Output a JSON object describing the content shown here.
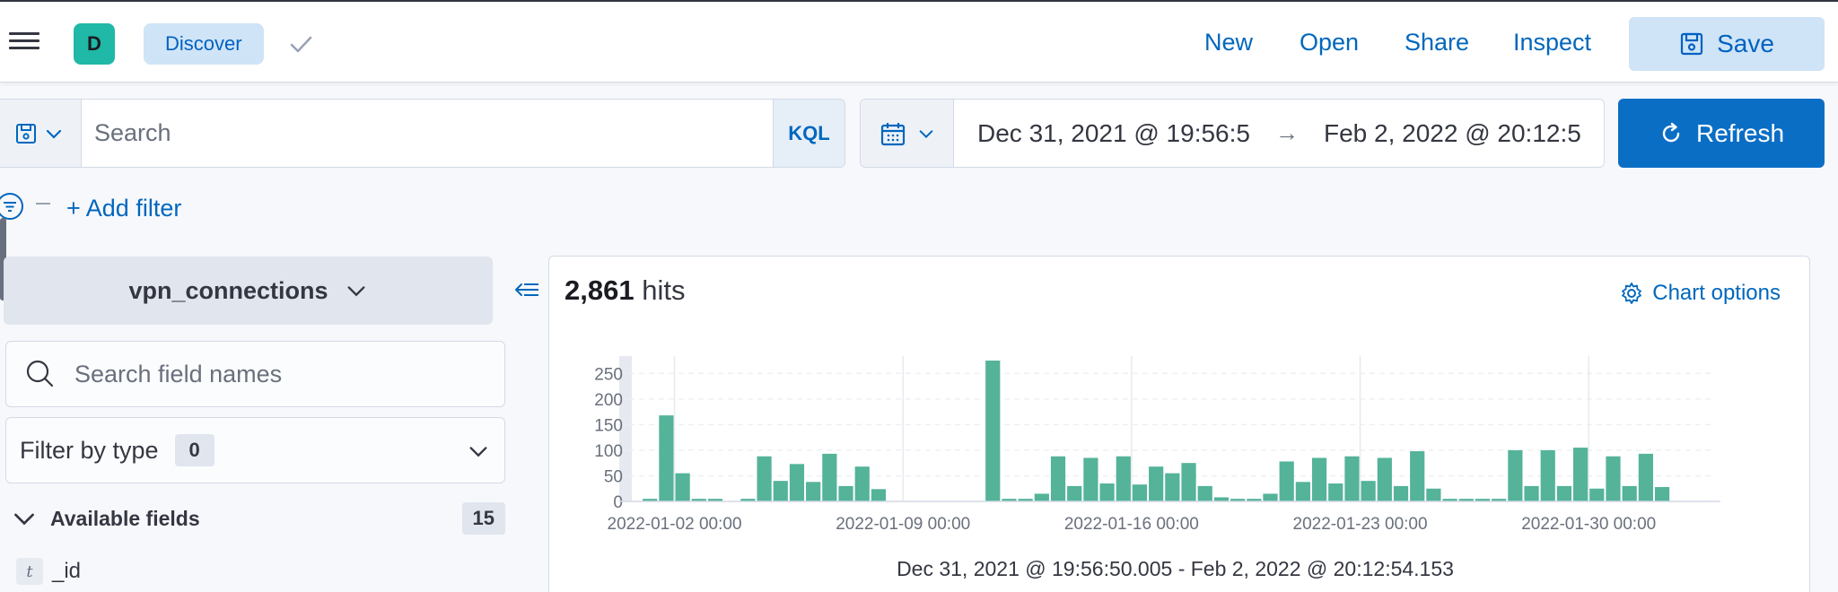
{
  "header": {
    "avatar_letter": "D",
    "breadcrumb": "Discover",
    "links": [
      "New",
      "Open",
      "Share",
      "Inspect"
    ],
    "save_label": "Save"
  },
  "query": {
    "placeholder": "Search",
    "language": "KQL",
    "date_start": "Dec 31, 2021 @ 19:56:5",
    "date_end": "Feb 2, 2022 @ 20:12:5",
    "refresh_label": "Refresh"
  },
  "filters": {
    "add_label": "+ Add filter"
  },
  "sidebar": {
    "index_pattern": "vpn_connections",
    "field_search_placeholder": "Search field names",
    "filter_by_type_label": "Filter by type",
    "filter_by_type_count": "0",
    "available_fields_label": "Available fields",
    "available_fields_count": "15",
    "fields": [
      {
        "type": "t",
        "name": "_id"
      }
    ]
  },
  "main": {
    "hits_count": "2,861",
    "hits_label": "hits",
    "chart_options_label": "Chart options"
  },
  "colors": {
    "bar": "#54b399",
    "accent": "#0b6ec5",
    "link": "#0067bd"
  },
  "chart_data": {
    "type": "bar",
    "xlabel": "Dec 31, 2021 @ 19:56:50.005 - Feb 2, 2022 @ 20:12:54.153",
    "ylabel": "",
    "ylim": [
      0,
      275
    ],
    "yticks": [
      0,
      50,
      100,
      150,
      200,
      250
    ],
    "x_tick_labels": [
      "2022-01-02 00:00",
      "2022-01-09 00:00",
      "2022-01-16 00:00",
      "2022-01-23 00:00",
      "2022-01-30 00:00"
    ],
    "interval": "12 hours",
    "values": [
      5,
      168,
      55,
      5,
      5,
      0,
      0,
      5,
      88,
      40,
      73,
      38,
      93,
      30,
      68,
      24,
      0,
      0,
      0,
      0,
      0,
      0,
      0,
      0,
      0,
      0,
      0,
      0,
      0,
      0,
      0,
      0,
      0,
      0,
      0,
      0,
      0,
      0,
      0,
      0,
      0,
      0,
      0,
      0,
      0,
      0,
      0,
      0,
      0,
      0,
      0,
      0,
      0,
      0,
      0,
      0,
      0,
      0,
      0,
      0,
      0,
      0,
      0,
      0
    ],
    "series": [
      {
        "name": "Count",
        "values": [
          5,
          168,
          55,
          5,
          5,
          0,
          0,
          5,
          88,
          40,
          73,
          38,
          93,
          30,
          68,
          24,
          0,
          0,
          0,
          0,
          0,
          0,
          0,
          0,
          0,
          0,
          0,
          0,
          0,
          0,
          0,
          0,
          0,
          0,
          0,
          0,
          0,
          0,
          0,
          0,
          0,
          0,
          0,
          0,
          0,
          0,
          0,
          0,
          0,
          0,
          0,
          0,
          0,
          0,
          0,
          0,
          0,
          0,
          0,
          0,
          0,
          0,
          0,
          0
        ]
      }
    ],
    "bars": [
      {
        "t": "2022-01-01 00:00",
        "v": 5
      },
      {
        "t": "2022-01-01 12:00",
        "v": 168
      },
      {
        "t": "2022-01-02 00:00",
        "v": 55
      },
      {
        "t": "2022-01-02 12:00",
        "v": 5
      },
      {
        "t": "2022-01-03 00:00",
        "v": 5
      },
      {
        "t": "2022-01-04 00:00",
        "v": 5
      },
      {
        "t": "2022-01-04 12:00",
        "v": 88
      },
      {
        "t": "2022-01-05 00:00",
        "v": 40
      },
      {
        "t": "2022-01-05 12:00",
        "v": 73
      },
      {
        "t": "2022-01-06 00:00",
        "v": 38
      },
      {
        "t": "2022-01-06 12:00",
        "v": 93
      },
      {
        "t": "2022-01-07 00:00",
        "v": 30
      },
      {
        "t": "2022-01-07 12:00",
        "v": 68
      },
      {
        "t": "2022-01-08 00:00",
        "v": 24
      },
      {
        "t": "2022-01-11 12:00",
        "v": 275
      },
      {
        "t": "2022-01-12 00:00",
        "v": 5
      },
      {
        "t": "2022-01-12 12:00",
        "v": 5
      },
      {
        "t": "2022-01-13 00:00",
        "v": 15
      },
      {
        "t": "2022-01-13 12:00",
        "v": 88
      },
      {
        "t": "2022-01-14 00:00",
        "v": 30
      },
      {
        "t": "2022-01-14 12:00",
        "v": 85
      },
      {
        "t": "2022-01-15 00:00",
        "v": 35
      },
      {
        "t": "2022-01-15 12:00",
        "v": 88
      },
      {
        "t": "2022-01-16 00:00",
        "v": 33
      },
      {
        "t": "2022-01-16 12:00",
        "v": 68
      },
      {
        "t": "2022-01-17 00:00",
        "v": 55
      },
      {
        "t": "2022-01-17 12:00",
        "v": 75
      },
      {
        "t": "2022-01-18 00:00",
        "v": 30
      },
      {
        "t": "2022-01-18 12:00",
        "v": 8
      },
      {
        "t": "2022-01-19 00:00",
        "v": 5
      },
      {
        "t": "2022-01-19 12:00",
        "v": 5
      },
      {
        "t": "2022-01-20 00:00",
        "v": 15
      },
      {
        "t": "2022-01-20 12:00",
        "v": 78
      },
      {
        "t": "2022-01-21 00:00",
        "v": 38
      },
      {
        "t": "2022-01-21 12:00",
        "v": 85
      },
      {
        "t": "2022-01-22 00:00",
        "v": 35
      },
      {
        "t": "2022-01-22 12:00",
        "v": 88
      },
      {
        "t": "2022-01-23 00:00",
        "v": 40
      },
      {
        "t": "2022-01-23 12:00",
        "v": 85
      },
      {
        "t": "2022-01-24 00:00",
        "v": 30
      },
      {
        "t": "2022-01-24 12:00",
        "v": 98
      },
      {
        "t": "2022-01-25 00:00",
        "v": 25
      },
      {
        "t": "2022-01-25 12:00",
        "v": 5
      },
      {
        "t": "2022-01-26 00:00",
        "v": 5
      },
      {
        "t": "2022-01-26 12:00",
        "v": 5
      },
      {
        "t": "2022-01-27 00:00",
        "v": 5
      },
      {
        "t": "2022-01-27 12:00",
        "v": 100
      },
      {
        "t": "2022-01-28 00:00",
        "v": 30
      },
      {
        "t": "2022-01-28 12:00",
        "v": 100
      },
      {
        "t": "2022-01-29 00:00",
        "v": 30
      },
      {
        "t": "2022-01-29 12:00",
        "v": 105
      },
      {
        "t": "2022-01-30 00:00",
        "v": 25
      },
      {
        "t": "2022-01-30 12:00",
        "v": 88
      },
      {
        "t": "2022-01-31 00:00",
        "v": 30
      },
      {
        "t": "2022-01-31 12:00",
        "v": 93
      },
      {
        "t": "2022-02-01 00:00",
        "v": 28
      }
    ]
  }
}
